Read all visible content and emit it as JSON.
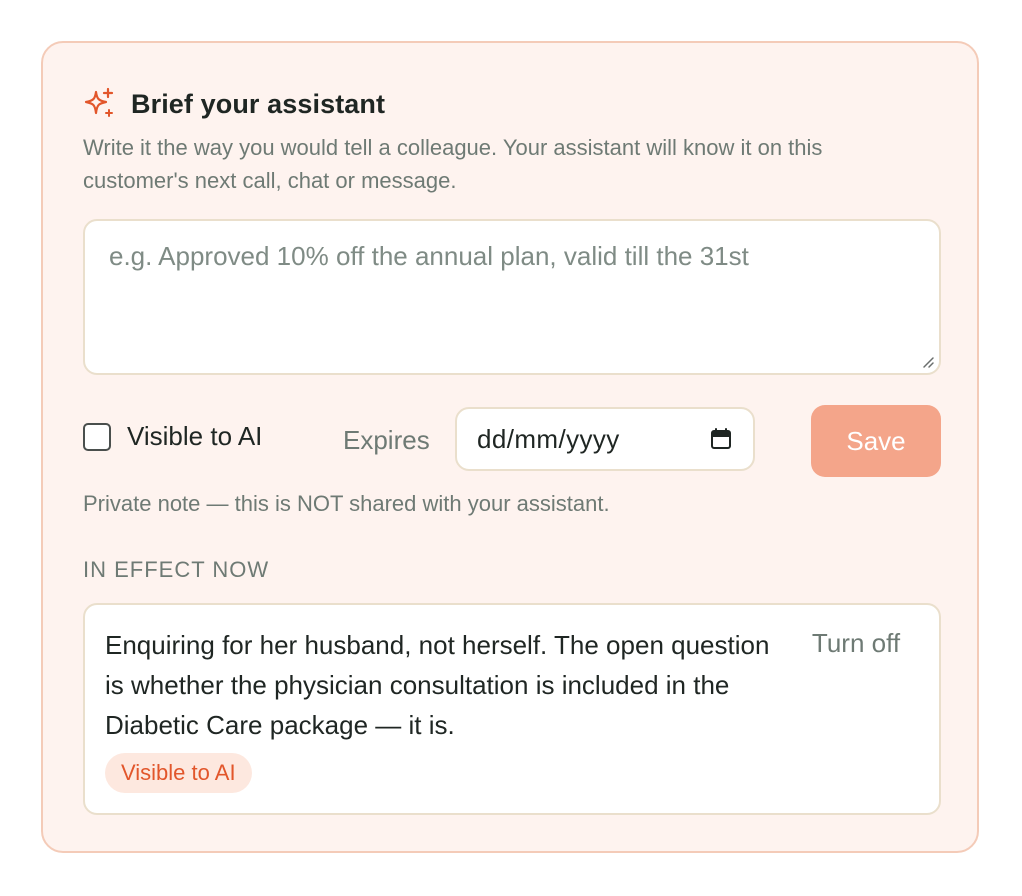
{
  "brief": {
    "title": "Brief your assistant",
    "title_icon": "sparkle-icon",
    "subtitle": "Write it the way you would tell a colleague. Your assistant will know it on this customer's next call, chat or message.",
    "input_placeholder": "e.g. Approved 10% off the annual plan, valid till the 31st",
    "input_value": ""
  },
  "controls": {
    "visible_label": "Visible to AI",
    "visible_checked": false,
    "expires_label": "Expires",
    "date_value": "dd/mm/yyyy",
    "save_label": "Save"
  },
  "private_note": "Private note — this is NOT shared with your assistant.",
  "in_effect": {
    "heading": "IN EFFECT NOW",
    "notes": [
      {
        "text": "Enquiring for her husband, not herself. The open question is whether the physician consultation is included in the Diabetic Care package — it is.",
        "action_label": "Turn off",
        "badge": "Visible to AI"
      }
    ]
  },
  "colors": {
    "accent": "#e2562b",
    "card_background": "#fef3ef",
    "card_border": "#f4cbb8",
    "save_button": "#f4a58a",
    "muted_text": "#6e7a74"
  }
}
